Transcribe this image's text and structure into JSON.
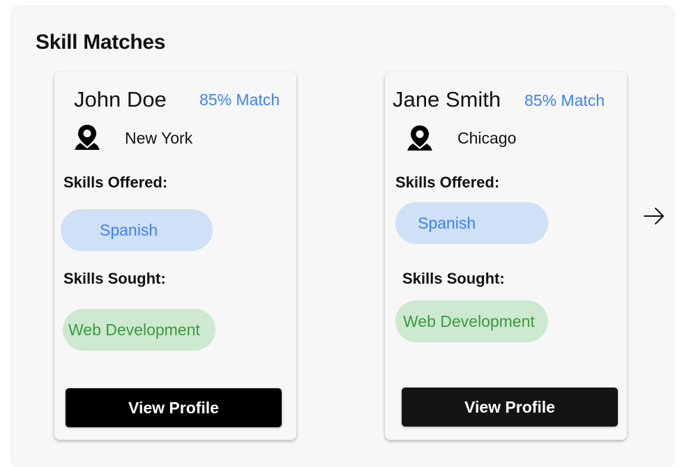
{
  "section": {
    "title": "Skill Matches"
  },
  "cards": [
    {
      "name": "John Doe",
      "match": "85% Match",
      "location": "New York",
      "skills_offered_label": "Skills Offered:",
      "skills_offered": [
        "Spanish"
      ],
      "skills_sought_label": "Skills Sought:",
      "skills_sought": [
        "Web Development"
      ],
      "button_label": "View Profile"
    },
    {
      "name": "Jane Smith",
      "match": "85% Match",
      "location": "Chicago",
      "skills_offered_label": "Skills Offered:",
      "skills_offered": [
        "Spanish"
      ],
      "skills_sought_label": "Skills Sought:",
      "skills_sought": [
        "Web Development"
      ],
      "button_label": "View Profile"
    }
  ],
  "navigation": {
    "next_icon": "arrow-right-icon"
  },
  "colors": {
    "accent_blue": "#3b82f6",
    "pill_blue_bg": "#cfe0f7",
    "pill_green_bg": "#cde9d0",
    "pill_green_text": "#3a9a3f",
    "button_bg": "#000000",
    "button_text": "#ffffff"
  }
}
